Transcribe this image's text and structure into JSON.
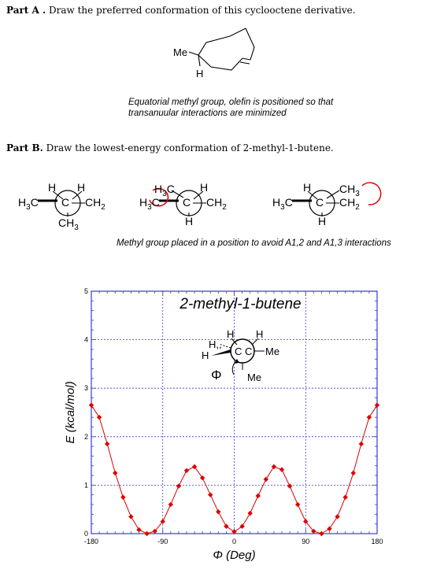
{
  "partA": {
    "label": "Part A .",
    "prompt": "Draw the preferred conformation of this cyclooctene derivative.",
    "substituent": "Me",
    "hydrogen": "H",
    "caption_line1": "Equatorial methyl group, olefin is positioned so that",
    "caption_line2": "transanuular interactions are minimized"
  },
  "partB": {
    "label": "Part B.",
    "prompt": "Draw the lowest-energy conformation of 2-methyl-1-butene.",
    "caption": "Methyl group placed in a position to avoid A1,2 and A1,3 interactions",
    "labels": {
      "H": "H",
      "C": "C",
      "H3C_H": "H",
      "H3C_3": "3",
      "H3C_C": "C",
      "CH2_C": "CH",
      "CH2_2": "2",
      "CH3_C": "CH",
      "CH3_3": "3"
    }
  },
  "chart_data": {
    "type": "scatter",
    "title": "2-methyl-1-butene",
    "xlabel": "Φ (Deg)",
    "ylabel": "E (kcal/mol)",
    "xlim": [
      -180,
      180
    ],
    "ylim": [
      0,
      5
    ],
    "xticks": [
      -180,
      -90,
      0,
      90,
      180
    ],
    "xtick_labels": [
      "-180",
      "-90",
      "0",
      "90",
      "180"
    ],
    "yticks": [
      0,
      1,
      2,
      3,
      4,
      5
    ],
    "ytick_labels": [
      "0",
      "1",
      "2",
      "3",
      "4",
      "5"
    ],
    "grid": true,
    "series": [
      {
        "color": "#dd0000",
        "x": [
          -180,
          -170,
          -160,
          -150,
          -140,
          -130,
          -120,
          -110,
          -100,
          -90,
          -80,
          -70,
          -60,
          -50,
          -40,
          -30,
          -20,
          -10,
          0,
          10,
          20,
          30,
          40,
          50,
          60,
          70,
          80,
          90,
          100,
          110,
          120,
          130,
          140,
          150,
          160,
          170,
          180
        ],
        "y": [
          2.65,
          2.4,
          1.85,
          1.25,
          0.75,
          0.35,
          0.08,
          0.0,
          0.05,
          0.25,
          0.6,
          0.98,
          1.3,
          1.38,
          1.15,
          0.8,
          0.45,
          0.15,
          0.04,
          0.15,
          0.42,
          0.78,
          1.12,
          1.38,
          1.32,
          0.98,
          0.6,
          0.25,
          0.05,
          0.0,
          0.1,
          0.35,
          0.75,
          1.25,
          1.85,
          2.4,
          2.65
        ]
      }
    ],
    "inset": {
      "H_top_left": "H",
      "H_top_right": "H",
      "H_left_upper": "H",
      "H_left_lower": "H",
      "C_front": "C",
      "C_back": "C",
      "Me_right": "Me",
      "Me_bottom": "Me",
      "phi": "Φ"
    }
  }
}
